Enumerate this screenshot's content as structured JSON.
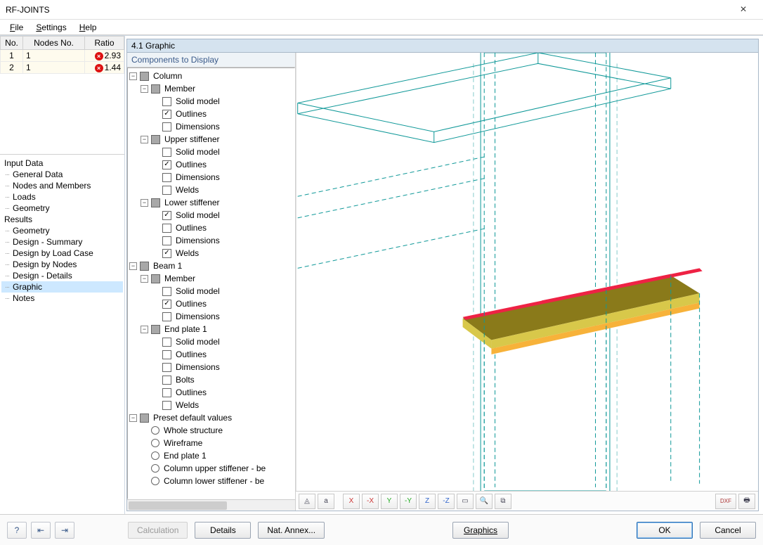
{
  "window": {
    "title": "RF-JOINTS"
  },
  "menu": {
    "file": "File",
    "settings": "Settings",
    "help": "Help"
  },
  "left_table": {
    "headers": [
      "No.",
      "Nodes No.",
      "Ratio"
    ],
    "rows": [
      {
        "no": "1",
        "nodes": "1",
        "ratio": "2.93"
      },
      {
        "no": "2",
        "nodes": "1",
        "ratio": "1.44"
      }
    ]
  },
  "nav": {
    "input_label": "Input Data",
    "input_items": [
      "General Data",
      "Nodes and Members",
      "Loads",
      "Geometry"
    ],
    "results_label": "Results",
    "results_items": [
      "Geometry",
      "Design - Summary",
      "Design by Load Case",
      "Design by Nodes",
      "Design - Details",
      "Graphic",
      "Notes"
    ],
    "selected": "Graphic"
  },
  "panel_title": "4.1 Graphic",
  "comp_title": "Components to Display",
  "tree": {
    "column": "Column",
    "member": "Member",
    "solid_model": "Solid model",
    "outlines": "Outlines",
    "dimensions": "Dimensions",
    "welds": "Welds",
    "upper_stiffener": "Upper stiffener",
    "lower_stiffener": "Lower stiffener",
    "beam1": "Beam 1",
    "end_plate1": "End plate 1",
    "bolts": "Bolts",
    "preset": "Preset default values",
    "preset_whole": "Whole structure",
    "preset_wire": "Wireframe",
    "preset_ep1": "End plate 1",
    "preset_cus": "Column upper stiffener - be",
    "preset_cls": "Column lower stiffener - be"
  },
  "toolbar_icons": {
    "iso": "iso-view-icon",
    "text": "text-view-icon",
    "xv": "view-x-icon",
    "xvn": "view-neg-x-icon",
    "yv": "view-y-icon",
    "yvn": "view-neg-y-icon",
    "zv": "view-z-icon",
    "zvn": "view-neg-z-icon",
    "box": "bounding-box-icon",
    "zoom": "zoom-icon",
    "copy": "copy-icon",
    "dxf": "dxf-export-icon",
    "print": "print-icon"
  },
  "bottom": {
    "help": "help-icon",
    "prev": "prev-panel-icon",
    "next": "next-panel-icon",
    "calculation": "Calculation",
    "details": "Details",
    "annex": "Nat. Annex...",
    "graphics": "Graphics",
    "ok": "OK",
    "cancel": "Cancel"
  }
}
